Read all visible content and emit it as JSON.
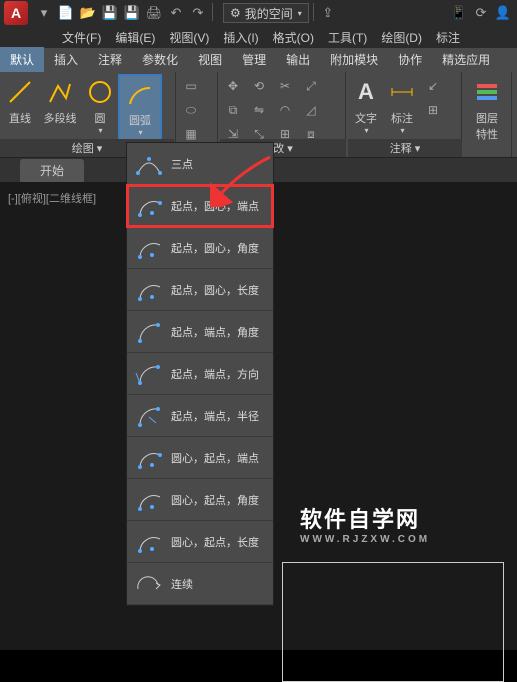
{
  "titlebar": {
    "logo_text": "A",
    "workspace": {
      "icon": "gear",
      "label": "我的空间",
      "chevron": "▾"
    }
  },
  "menubar": {
    "items": [
      "文件(F)",
      "编辑(E)",
      "视图(V)",
      "插入(I)",
      "格式(O)",
      "工具(T)",
      "绘图(D)",
      "标注"
    ]
  },
  "ribbon": {
    "tabs": [
      "默认",
      "插入",
      "注释",
      "参数化",
      "视图",
      "管理",
      "输出",
      "附加模块",
      "协作",
      "精选应用"
    ],
    "active_tab": 0,
    "draw_panel": {
      "tools": [
        {
          "label": "直线"
        },
        {
          "label": "多段线"
        },
        {
          "label": "圆"
        },
        {
          "label": "圆弧",
          "active": true
        }
      ],
      "footer": "绘图 ▾"
    },
    "modify_footer": "改 ▾",
    "annotate": {
      "text": "文字",
      "dim": "标注",
      "footer": "注释 ▾"
    },
    "layers": {
      "label": "图层\n特性"
    }
  },
  "doc_tabs": {
    "start": "开始",
    "add": "+"
  },
  "viewport": {
    "label": "[-][俯视][二维线框]"
  },
  "arc_menu": {
    "items": [
      "三点",
      "起点，圆心，端点",
      "起点，圆心，角度",
      "起点，圆心，长度",
      "起点，端点，角度",
      "起点，端点，方向",
      "起点，端点，半径",
      "圆心，起点，端点",
      "圆心，起点，角度",
      "圆心，起点，长度",
      "连续"
    ],
    "highlight_index": 1
  },
  "watermark": {
    "main": "软件自学网",
    "sub": "WWW.RJZXW.COM"
  }
}
